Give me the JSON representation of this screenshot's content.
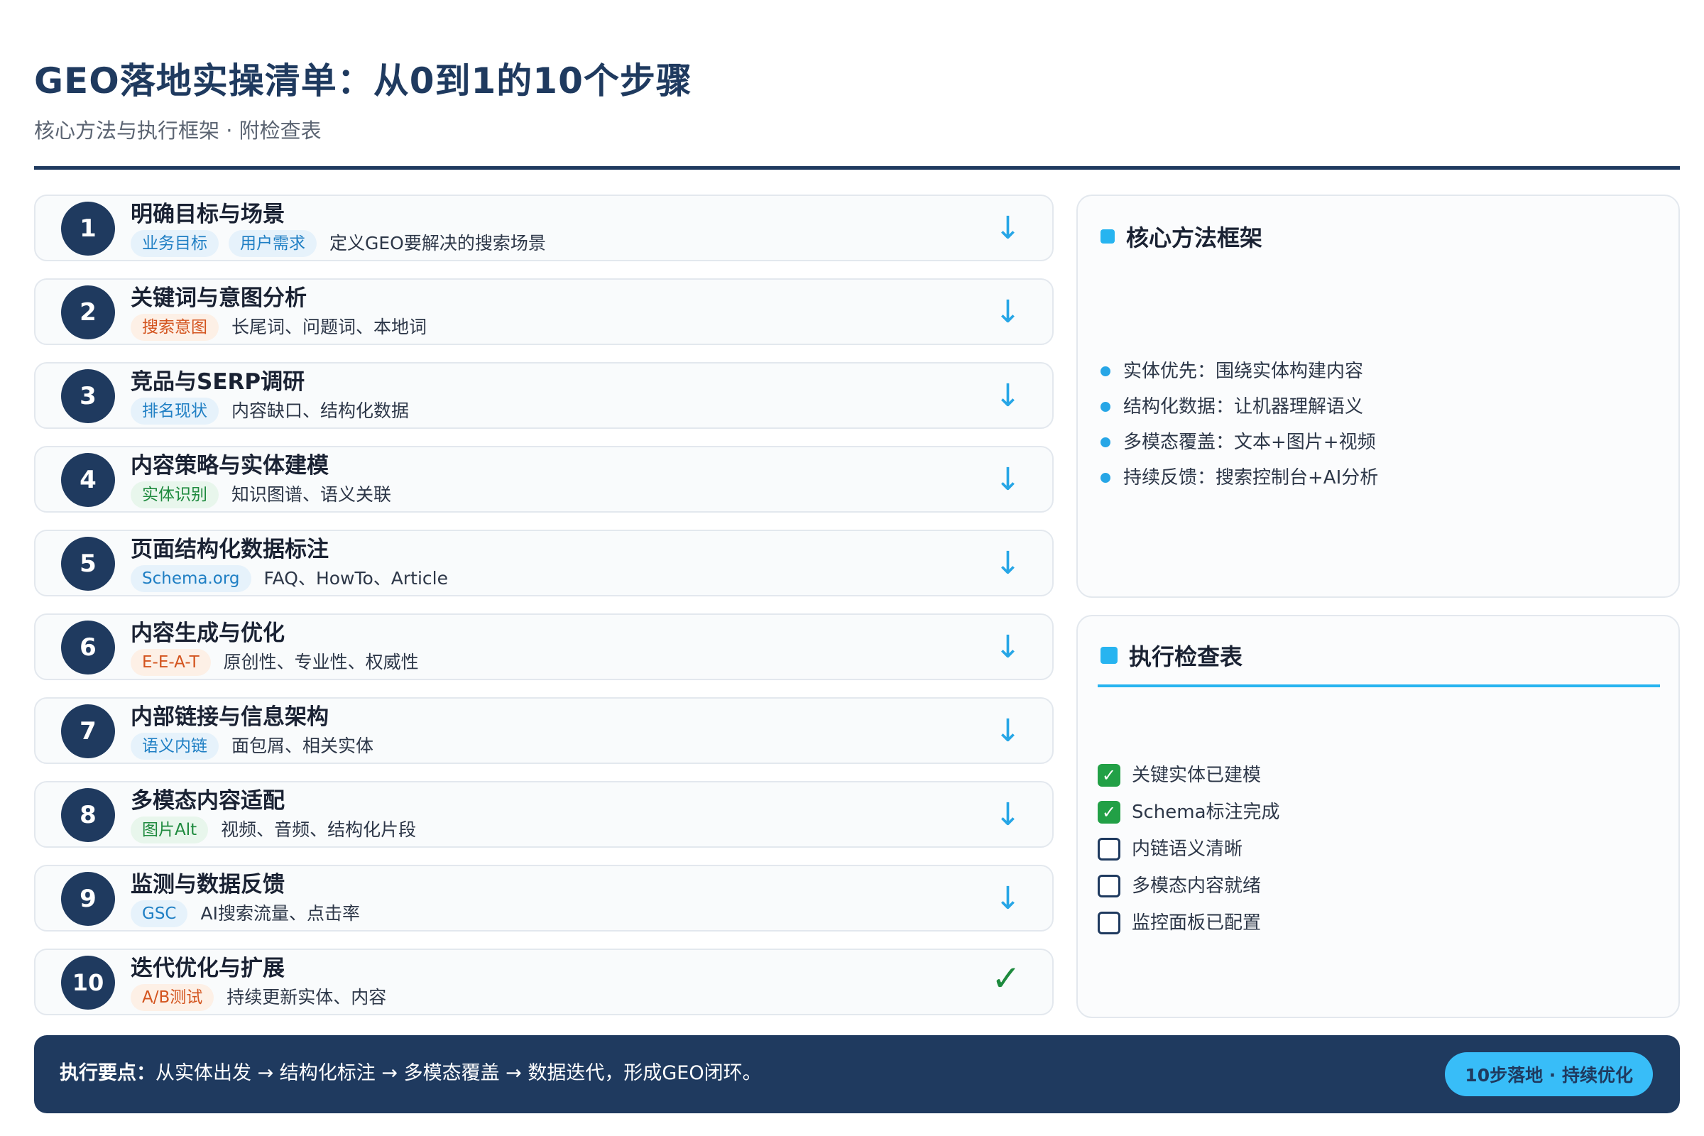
{
  "header": {
    "title": "GEO落地实操清单：从0到1的10个步骤",
    "subtitle": "核心方法与执行框架 · 附检查表"
  },
  "steps": [
    {
      "num": "1",
      "title": "明确目标与场景",
      "tags": [
        {
          "label": "业务目标",
          "color": "blue"
        },
        {
          "label": "用户需求",
          "color": "blue"
        }
      ],
      "desc": "定义GEO要解决的搜索场景",
      "icon": "arrow-down-icon"
    },
    {
      "num": "2",
      "title": "关键词与意图分析",
      "tags": [
        {
          "label": "搜索意图",
          "color": "orange"
        }
      ],
      "desc": "长尾词、问题词、本地词",
      "icon": "arrow-down-icon"
    },
    {
      "num": "3",
      "title": "竞品与SERP调研",
      "tags": [
        {
          "label": "排名现状",
          "color": "blue"
        }
      ],
      "desc": "内容缺口、结构化数据",
      "icon": "arrow-down-icon"
    },
    {
      "num": "4",
      "title": "内容策略与实体建模",
      "tags": [
        {
          "label": "实体识别",
          "color": "green"
        }
      ],
      "desc": "知识图谱、语义关联",
      "icon": "arrow-down-icon"
    },
    {
      "num": "5",
      "title": "页面结构化数据标注",
      "tags": [
        {
          "label": "Schema.org",
          "color": "blue"
        }
      ],
      "desc": "FAQ、HowTo、Article",
      "icon": "arrow-down-icon"
    },
    {
      "num": "6",
      "title": "内容生成与优化",
      "tags": [
        {
          "label": "E-E-A-T",
          "color": "orange"
        }
      ],
      "desc": "原创性、专业性、权威性",
      "icon": "arrow-down-icon"
    },
    {
      "num": "7",
      "title": "内部链接与信息架构",
      "tags": [
        {
          "label": "语义内链",
          "color": "blue"
        }
      ],
      "desc": "面包屑、相关实体",
      "icon": "arrow-down-icon"
    },
    {
      "num": "8",
      "title": "多模态内容适配",
      "tags": [
        {
          "label": "图片Alt",
          "color": "green"
        }
      ],
      "desc": "视频、音频、结构化片段",
      "icon": "arrow-down-icon"
    },
    {
      "num": "9",
      "title": "监测与数据反馈",
      "tags": [
        {
          "label": "GSC",
          "color": "blue"
        }
      ],
      "desc": "AI搜索流量、点击率",
      "icon": "arrow-down-icon"
    },
    {
      "num": "10",
      "title": "迭代优化与扩展",
      "tags": [
        {
          "label": "A/B测试",
          "color": "orange"
        }
      ],
      "desc": "持续更新实体、内容",
      "icon": "checkmark-icon"
    }
  ],
  "framework": {
    "title": "核心方法框架",
    "items": [
      "实体优先：围绕实体构建内容",
      "结构化数据：让机器理解语义",
      "多模态覆盖：文本+图片+视频",
      "持续反馈：搜索控制台+AI分析"
    ]
  },
  "checklist": {
    "title": "执行检查表",
    "items": [
      {
        "label": "关键实体已建模",
        "checked": true
      },
      {
        "label": "Schema标注完成",
        "checked": true
      },
      {
        "label": "内链语义清晰",
        "checked": false
      },
      {
        "label": "多模态内容就绪",
        "checked": false
      },
      {
        "label": "监控面板已配置",
        "checked": false
      }
    ]
  },
  "footer": {
    "label": "执行要点：",
    "text": "从实体出发 → 结构化标注 → 多模态覆盖 → 数据迭代，形成GEO闭环。",
    "pill": "10步落地 · 持续优化"
  },
  "colors": {
    "navy": "#1f3a5f",
    "accent": "#27b4f0",
    "tag_blue": "#1f7fc4",
    "tag_orange": "#d3541e",
    "tag_green": "#1e8a3e",
    "check_green": "#22a046"
  }
}
